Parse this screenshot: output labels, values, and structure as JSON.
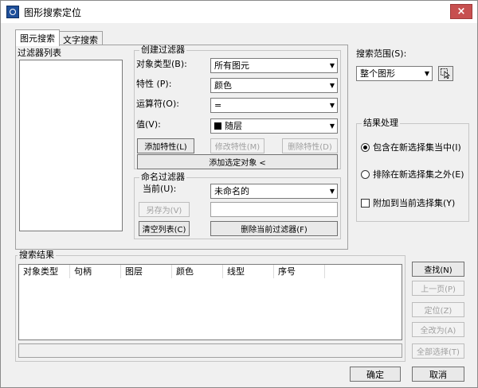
{
  "window": {
    "title": "图形搜索定位",
    "close_symbol": "×"
  },
  "tabs": [
    {
      "label": "图元搜索",
      "active": true
    },
    {
      "label": "文字搜索",
      "active": false
    }
  ],
  "filter_list": {
    "label": "过滤器列表"
  },
  "create_filter": {
    "title": "创建过滤器",
    "object_type": {
      "label": "对象类型(B):",
      "value": "所有图元"
    },
    "property": {
      "label": "特性 (P):",
      "value": "颜色"
    },
    "operator": {
      "label": "运算符(O):",
      "value": "="
    },
    "value": {
      "label": "值(V):",
      "value": "随层"
    },
    "add_property": "添加特性(L)",
    "modify_property": "修改特性(M)",
    "delete_property": "删除特性(D)",
    "add_selected": "添加选定对象 <"
  },
  "named_filter": {
    "title": "命名过滤器",
    "current_label": "当前(U):",
    "current_value": "未命名的",
    "save_as": "另存为(V)",
    "clear_list": "清空列表(C)",
    "delete_current": "删除当前过滤器(F)"
  },
  "search_scope": {
    "label": "搜索范围(S):",
    "value": "整个图形"
  },
  "result_handling": {
    "title": "结果处理",
    "option_include": "包含在新选择集当中(I)",
    "option_exclude": "排除在新选择集之外(E)",
    "option_append": "附加到当前选择集(Y)"
  },
  "search_results": {
    "title": "搜索结果",
    "columns": [
      "对象类型",
      "句柄",
      "图层",
      "颜色",
      "线型",
      "序号"
    ]
  },
  "side_buttons": {
    "find": "查找(N)",
    "prev_page": "上一页(P)",
    "locate": "定位(Z)",
    "change_all": "全改为(A)",
    "select_all": "全部选择(T)"
  },
  "footer": {
    "ok": "确定",
    "cancel": "取消"
  },
  "colors": {
    "close": "#c75050",
    "icon": "#1e4f9a",
    "background": "#f0f0f0"
  }
}
